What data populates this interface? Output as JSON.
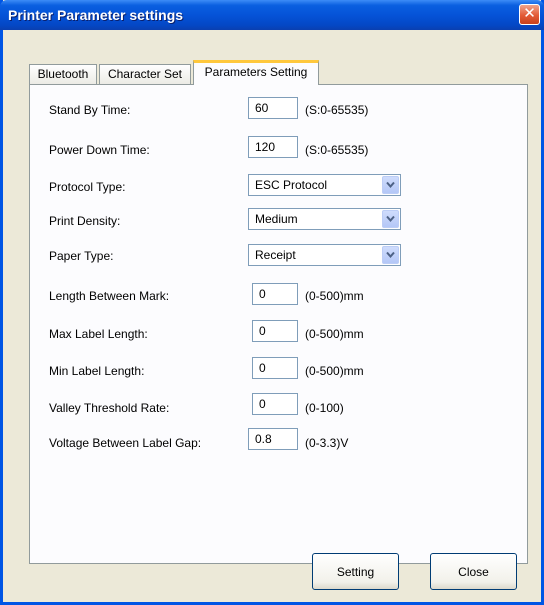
{
  "window": {
    "title": "Printer Parameter settings"
  },
  "tabs": [
    {
      "label": "Bluetooth",
      "active": false
    },
    {
      "label": "Character Set",
      "active": false
    },
    {
      "label": "Parameters Setting",
      "active": true
    }
  ],
  "fields": {
    "stand_by_time": {
      "label": "Stand By Time:",
      "value": "60",
      "hint": "(S:0-65535)"
    },
    "power_down_time": {
      "label": "Power Down Time:",
      "value": "120",
      "hint": "(S:0-65535)"
    },
    "protocol_type": {
      "label": "Protocol Type:",
      "value": "ESC Protocol"
    },
    "print_density": {
      "label": "Print Density:",
      "value": "Medium"
    },
    "paper_type": {
      "label": "Paper Type:",
      "value": "Receipt"
    },
    "length_between_mark": {
      "label": "Length Between Mark:",
      "value": "0",
      "hint": "(0-500)mm"
    },
    "max_label_length": {
      "label": "Max Label Length:",
      "value": "0",
      "hint": "(0-500)mm"
    },
    "min_label_length": {
      "label": "Min Label Length:",
      "value": "0",
      "hint": "(0-500)mm"
    },
    "valley_threshold": {
      "label": "Valley Threshold Rate:",
      "value": "0",
      "hint": "(0-100)"
    },
    "voltage_label_gap": {
      "label": "Voltage Between Label Gap:",
      "value": "0.8",
      "hint": "(0-3.3)V"
    }
  },
  "buttons": {
    "setting": "Setting",
    "close": "Close"
  },
  "icons": {
    "close": "close-x-icon",
    "dropdown": "chevron-down-icon"
  },
  "colors": {
    "titlebar": "#0553d8",
    "close_button": "#e35a35",
    "window_bg": "#ece9d8",
    "active_tab_accent": "#ffc83c"
  }
}
